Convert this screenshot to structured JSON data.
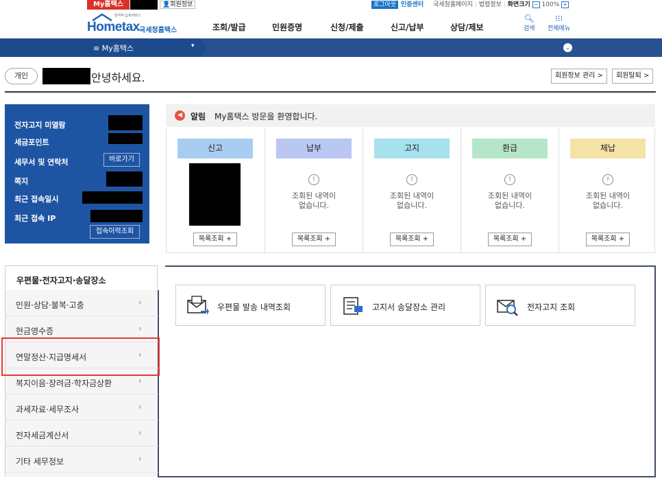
{
  "topbar": {
    "my_hometax": "My홈택스",
    "member_info": "회원정보",
    "logout": "로그아웃",
    "cert_center": "인증센터",
    "links": [
      "국세청홈페이지",
      "법령정보"
    ],
    "screen_size_label": "화면크기",
    "zoom_minus": "−",
    "zoom_value": "100%",
    "zoom_plus": "+"
  },
  "header": {
    "logo_text": "Hometax",
    "logo_sub": "국세청홈택스",
    "logo_tagline": "전자적 납세서비스",
    "nav": [
      "조회/발급",
      "민원증명",
      "신청/제출",
      "신고/납부",
      "상담/제보"
    ],
    "search_label": "검색",
    "menu_label": "전체메뉴"
  },
  "menubar": {
    "title": "≡  My홈택스",
    "caret": "▾",
    "right_toggle": "⌄"
  },
  "greeting": {
    "badge": "개인",
    "text": "안녕하세요.",
    "buttons": [
      "회원정보 관리 >",
      "회원탈퇴 >"
    ]
  },
  "info_panel": {
    "rows": [
      "전자고지 미열람",
      "세금포인트",
      "세무서 및 연락처",
      "쪽지",
      "최근 접속일시",
      "최근 접속 IP"
    ],
    "shortcut_button": "바로가기",
    "history_button": "접속이력조회"
  },
  "notice": {
    "label": "알림",
    "text": "My홈택스 방문을 환영합니다."
  },
  "status_columns": [
    {
      "title": "신고",
      "color": "#a9cdf0",
      "empty_msg": "",
      "button": "목록조회 +"
    },
    {
      "title": "납부",
      "color": "#b9c7f2",
      "empty_msg": "조회된 내역이\n없습니다.",
      "button": "목록조회 +"
    },
    {
      "title": "고지",
      "color": "#a6e1ed",
      "empty_msg": "조회된 내역이\n없습니다.",
      "button": "목록조회 +"
    },
    {
      "title": "환급",
      "color": "#b6e6c9",
      "empty_msg": "조회된 내역이\n없습니다.",
      "button": "목록조회 +"
    },
    {
      "title": "체납",
      "color": "#f5e2a6",
      "empty_msg": "조회된 내역이\n없습니다.",
      "button": "목록조회 +"
    }
  ],
  "sidebar": {
    "active_tab": "우편물·전자고지·송달장소",
    "items": [
      "민원·상담·불복·고충",
      "현금영수증",
      "연말정산·지급명세서",
      "복지이음·장려금·학자금상환",
      "과세자료·세무조사",
      "전자세금계산서",
      "기타 세무정보"
    ],
    "chevron": "›"
  },
  "cards": [
    {
      "label": "우편물 발송 내역조회",
      "icon": "mail-envelope-icon"
    },
    {
      "label": "고지서 송달장소 관리",
      "icon": "bill-document-icon"
    },
    {
      "label": "전자고지 조회",
      "icon": "e-notice-search-icon"
    }
  ]
}
